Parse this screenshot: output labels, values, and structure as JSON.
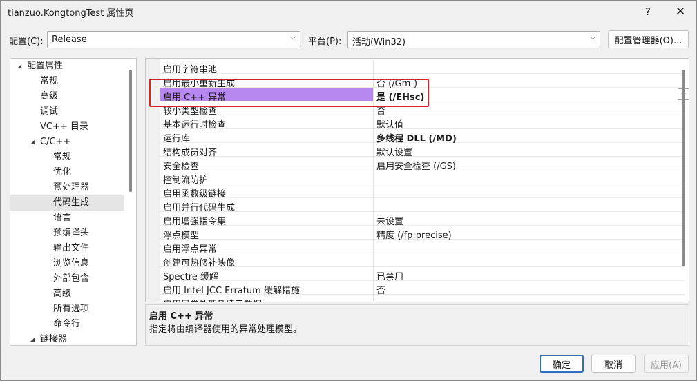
{
  "window": {
    "title": "tianzuo.KongtongTest 属性页",
    "help": "?",
    "close": "✕"
  },
  "config": {
    "config_label": "配置(C):",
    "config_value": "Release",
    "platform_label": "平台(P):",
    "platform_value": "活动(Win32)",
    "manager_button": "配置管理器(O)..."
  },
  "tree": {
    "items": [
      {
        "label": "配置属性",
        "level": 0,
        "expanded": true
      },
      {
        "label": "常规",
        "level": 1
      },
      {
        "label": "高级",
        "level": 1
      },
      {
        "label": "调试",
        "level": 1
      },
      {
        "label": "VC++ 目录",
        "level": 1
      },
      {
        "label": "C/C++",
        "level": 1,
        "expanded": true
      },
      {
        "label": "常规",
        "level": 2
      },
      {
        "label": "优化",
        "level": 2
      },
      {
        "label": "预处理器",
        "level": 2
      },
      {
        "label": "代码生成",
        "level": 2,
        "selected": true
      },
      {
        "label": "语言",
        "level": 2
      },
      {
        "label": "预编译头",
        "level": 2
      },
      {
        "label": "输出文件",
        "level": 2
      },
      {
        "label": "浏览信息",
        "level": 2
      },
      {
        "label": "外部包含",
        "level": 2
      },
      {
        "label": "高级",
        "level": 2
      },
      {
        "label": "所有选项",
        "level": 2
      },
      {
        "label": "命令行",
        "level": 2
      },
      {
        "label": "链接器",
        "level": 1,
        "expanded": true
      }
    ]
  },
  "grid": {
    "rows": [
      {
        "name": "启用字符串池",
        "value": ""
      },
      {
        "name": "启用最小重新生成",
        "value": "否 (/Gm-)"
      },
      {
        "name": "启用 C++ 异常",
        "value": "是 (/EHsc)",
        "bold": true,
        "selected": true
      },
      {
        "name": "较小类型检查",
        "value": "否"
      },
      {
        "name": "基本运行时检查",
        "value": "默认值"
      },
      {
        "name": "运行库",
        "value": "多线程 DLL (/MD)",
        "bold": true
      },
      {
        "name": "结构成员对齐",
        "value": "默认设置"
      },
      {
        "name": "安全检查",
        "value": "启用安全检查 (/GS)"
      },
      {
        "name": "控制流防护",
        "value": ""
      },
      {
        "name": "启用函数级链接",
        "value": ""
      },
      {
        "name": "启用并行代码生成",
        "value": ""
      },
      {
        "name": "启用增强指令集",
        "value": "未设置"
      },
      {
        "name": "浮点模型",
        "value": "精度 (/fp:precise)"
      },
      {
        "name": "启用浮点异常",
        "value": ""
      },
      {
        "name": "创建可热修补映像",
        "value": ""
      },
      {
        "name": "Spectre 缓解",
        "value": "已禁用"
      },
      {
        "name": "启用 Intel JCC Erratum 缓解措施",
        "value": "否"
      },
      {
        "name": "启用异常处理延续元数据",
        "value": ""
      }
    ]
  },
  "description": {
    "title": "启用 C++ 异常",
    "text": "指定将由编译器使用的异常处理模型。"
  },
  "buttons": {
    "ok": "确定",
    "cancel": "取消",
    "apply": "应用(A)"
  },
  "colors": {
    "selection": "#b788f0",
    "highlight_box": "#e02020",
    "primary_border": "#2f6fb6"
  }
}
